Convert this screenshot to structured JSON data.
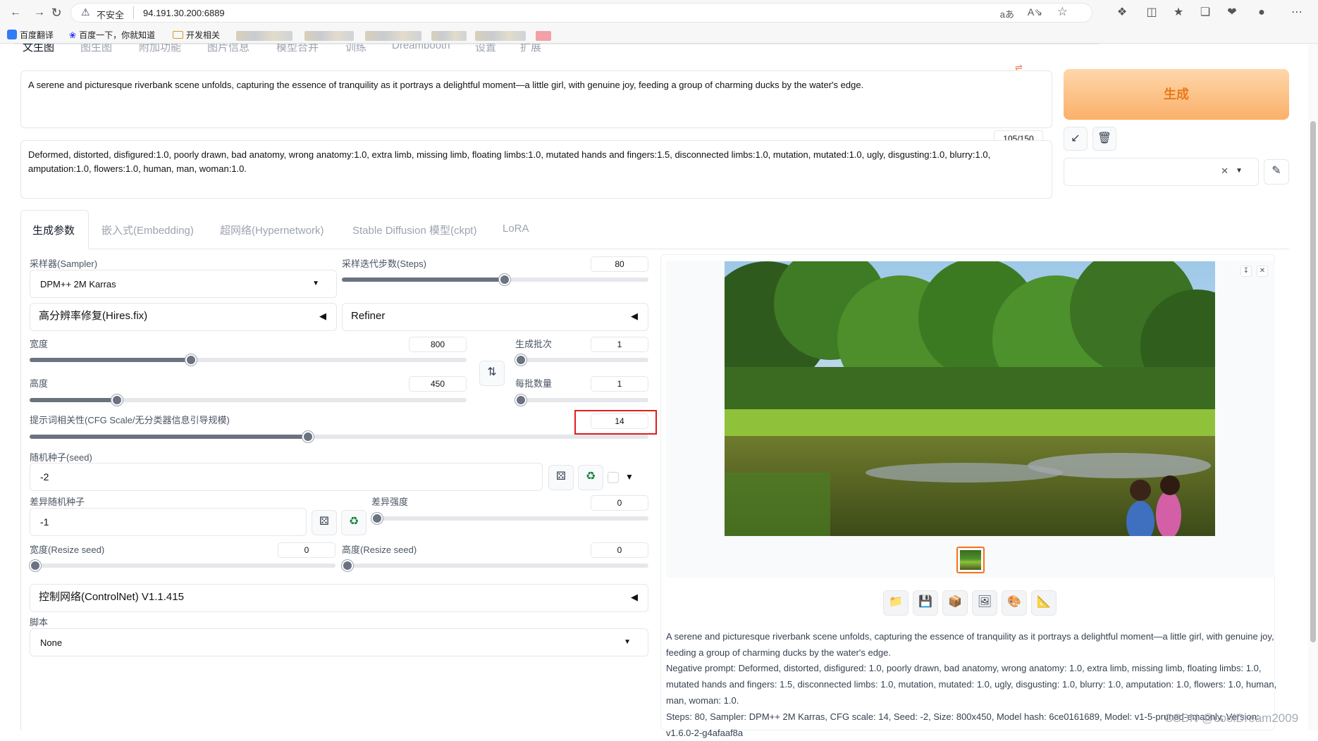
{
  "browser": {
    "security": "不安全",
    "url": "94.191.30.200:6889",
    "bookmarks": [
      "百度翻译",
      "百度一下，你就知道",
      "开发相关"
    ]
  },
  "top_tabs": [
    "文生图",
    "图生图",
    "附加功能",
    "图片信息",
    "模型合并",
    "训练",
    "Dreambooth",
    "设置",
    "扩展"
  ],
  "prompt": "A serene and picturesque riverbank scene unfolds, capturing the essence of tranquility as it portrays a delightful moment—a little girl, with genuine joy, feeding a group of charming ducks by the water's edge.",
  "negative_prompt": "Deformed, distorted, disfigured:1.0, poorly drawn, bad anatomy, wrong anatomy:1.0, extra limb, missing limb, floating limbs:1.0, mutated hands and fingers:1.5, disconnected limbs:1.0, mutation, mutated:1.0, ugly, disgusting:1.0, blurry:1.0, amputation:1.0, flowers:1.0, human, man, woman:1.0.",
  "token_counter": "105/150",
  "generate_label": "生成",
  "param_tabs": [
    "生成参数",
    "嵌入式(Embedding)",
    "超网络(Hypernetwork)",
    "Stable Diffusion 模型(ckpt)",
    "LoRA"
  ],
  "sampler": {
    "label": "采样器(Sampler)",
    "value": "DPM++ 2M Karras"
  },
  "steps": {
    "label": "采样迭代步数(Steps)",
    "value": "80",
    "level": 0.53
  },
  "hires_label": "高分辨率修复(Hires.fix)",
  "refiner_label": "Refiner",
  "width": {
    "label": "宽度",
    "value": "800",
    "level": 0.37
  },
  "height": {
    "label": "高度",
    "value": "450",
    "level": 0.2
  },
  "batch_count": {
    "label": "生成批次",
    "value": "1",
    "level": 0.0
  },
  "batch_size": {
    "label": "每批数量",
    "value": "1",
    "level": 0.0
  },
  "cfg": {
    "label": "提示词相关性(CFG Scale/无分类器信息引导规模)",
    "value": "14",
    "level": 0.45
  },
  "seed": {
    "label": "随机种子(seed)",
    "value": "-2"
  },
  "var_seed": {
    "label": "差异随机种子",
    "value": "-1"
  },
  "var_strength": {
    "label": "差异强度",
    "value": "0",
    "level": 0.0
  },
  "resize_w": {
    "label": "宽度(Resize seed)",
    "value": "0",
    "level": 0.0
  },
  "resize_h": {
    "label": "高度(Resize seed)",
    "value": "0",
    "level": 0.0
  },
  "controlnet_label": "控制网络(ControlNet) V1.1.415",
  "script": {
    "label": "脚本",
    "value": "None"
  },
  "output_info": {
    "prompt": "A serene and picturesque riverbank scene unfolds, capturing the essence of tranquility as it portrays a delightful moment—a little girl, with genuine joy, feeding a group of charming ducks by the water's edge.",
    "negative": "Negative prompt: Deformed, distorted, disfigured: 1.0, poorly drawn, bad anatomy, wrong anatomy: 1.0, extra limb, missing limb, floating limbs: 1.0, mutated hands and fingers: 1.5, disconnected limbs: 1.0, mutation, mutated: 1.0, ugly, disgusting: 1.0, blurry: 1.0, amputation: 1.0, flowers: 1.0, human, man, woman: 1.0.",
    "params": "Steps: 80, Sampler: DPM++ 2M Karras, CFG scale: 14, Seed: -2, Size: 800x450, Model hash: 6ce0161689, Model: v1-5-pruned-emaonly, Version: v1.6.0-2-g4afaaf8a"
  },
  "watermark": "CSDN @coolDream2009",
  "colors": {
    "generate_bg": "#fbbf85",
    "highlight": "#e11d1d",
    "thumb_border": "#f97316"
  }
}
